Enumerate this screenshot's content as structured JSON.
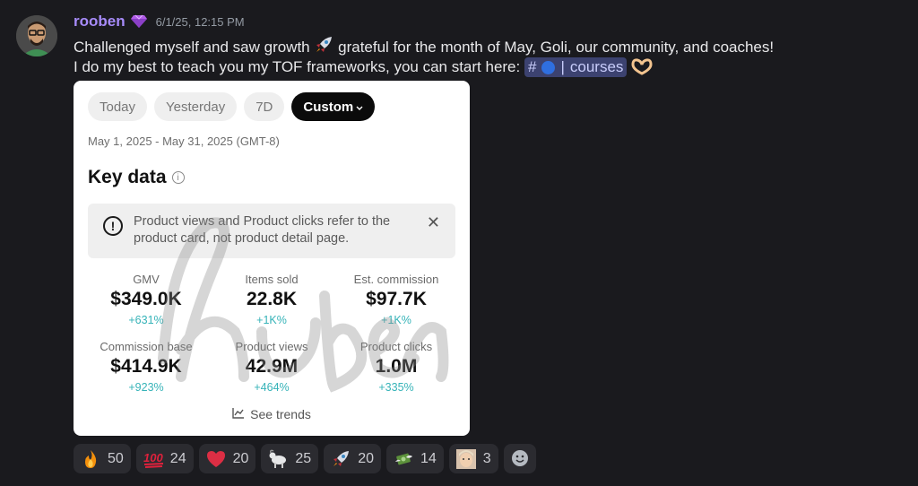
{
  "message": {
    "author": "rooben",
    "timestamp": "6/1/25, 12:15 PM",
    "line1_text": "Challenged myself and saw growth",
    "line1_rest": "grateful for the month of May, Goli, our community, and coaches!",
    "line2_text": "I do my best to teach you my TOF frameworks, you can start here:",
    "channel": {
      "hash": "#",
      "separator": "|",
      "name": "courses"
    }
  },
  "card": {
    "tabs": [
      "Today",
      "Yesterday",
      "7D",
      "Custom"
    ],
    "active_tab": "Custom",
    "date_range": "May 1, 2025 - May 31, 2025 (GMT-8)",
    "section_title": "Key data",
    "notice": "Product views and Product clicks refer to the product card, not product detail page.",
    "close_symbol": "✕",
    "watermark": "ruben",
    "metrics": [
      {
        "label": "GMV",
        "value": "$349.0K",
        "change": "+631%"
      },
      {
        "label": "Items sold",
        "value": "22.8K",
        "change": "+1K%"
      },
      {
        "label": "Est. commission",
        "value": "$97.7K",
        "change": "+1K%"
      },
      {
        "label": "Commission base",
        "value": "$414.9K",
        "change": "+923%"
      },
      {
        "label": "Product views",
        "value": "42.9M",
        "change": "+464%"
      },
      {
        "label": "Product clicks",
        "value": "1.0M",
        "change": "+335%"
      }
    ],
    "trends_label": "See trends"
  },
  "reactions": [
    {
      "icon": "fire-icon",
      "count": "50"
    },
    {
      "icon": "hundred-points-icon",
      "count": "24"
    },
    {
      "icon": "red-heart-icon",
      "count": "20"
    },
    {
      "icon": "goat-icon",
      "count": "25"
    },
    {
      "icon": "rocket-icon",
      "count": "20"
    },
    {
      "icon": "money-with-wings-icon",
      "count": "14"
    },
    {
      "icon": "custom-face-emoji-icon",
      "count": "3"
    }
  ],
  "colors": {
    "author": "#a78bfa",
    "accent_change": "#36b3b8",
    "mention_bg": "#3c4270"
  }
}
